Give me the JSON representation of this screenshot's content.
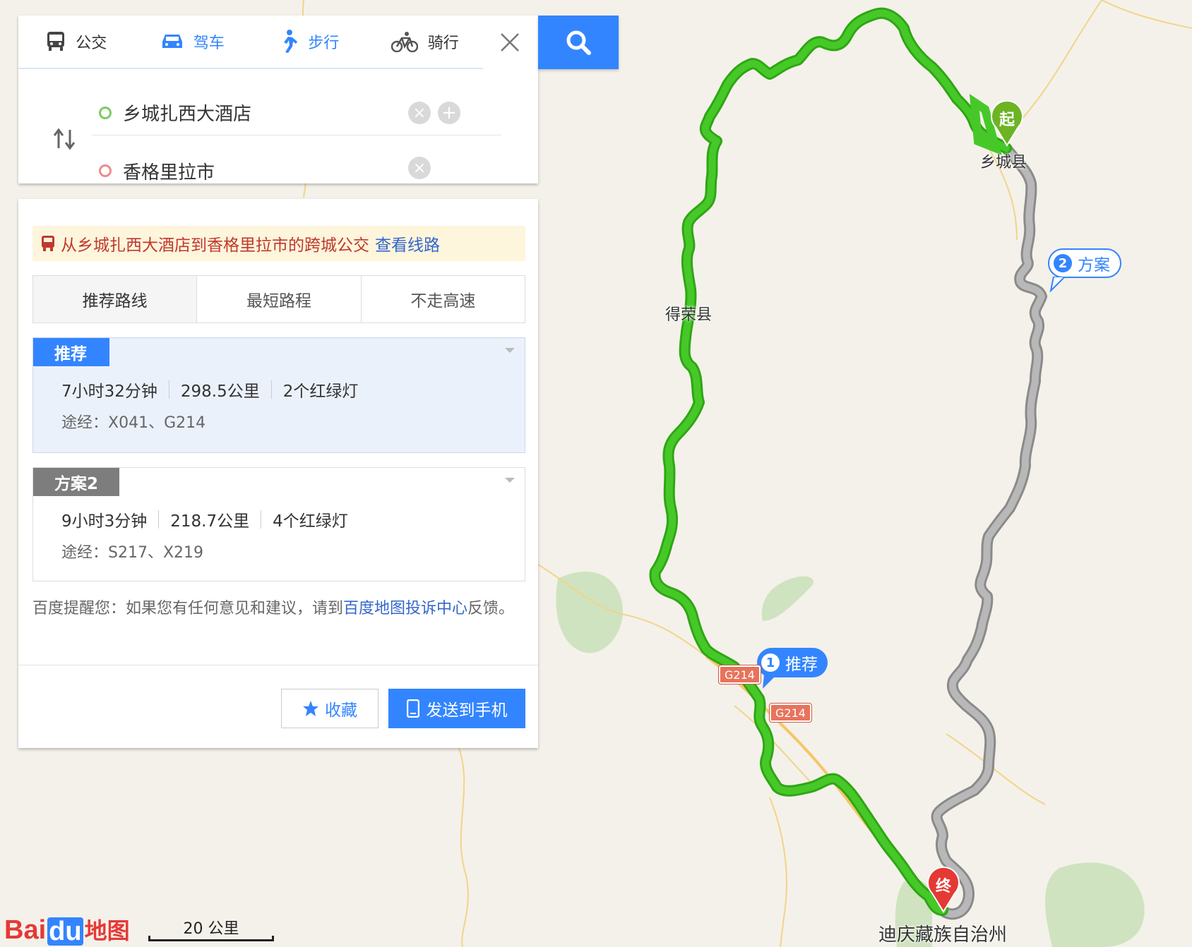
{
  "modes": {
    "bus": "公交",
    "drive": "驾车",
    "walk": "步行",
    "ride": "骑行"
  },
  "route": {
    "start": "乡城扎西大酒店",
    "end": "香格里拉市"
  },
  "bus_tip": {
    "text": "从乡城扎西大酒店到香格里拉市的跨城公交",
    "link": "查看线路"
  },
  "preferences": [
    "推荐路线",
    "最短路程",
    "不走高速"
  ],
  "plans": [
    {
      "tag": "推荐",
      "time": "7小时32分钟",
      "distance": "298.5公里",
      "lights": "2个红绿灯",
      "via": "途经：X041、G214"
    },
    {
      "tag": "方案2",
      "time": "9小时3分钟",
      "distance": "218.7公里",
      "lights": "4个红绿灯",
      "via": "途经：S217、X219"
    }
  ],
  "feedback": {
    "before": "百度提醒您：如果您有任何意见和建议，请到",
    "link": "百度地图投诉中心",
    "after": "反馈。"
  },
  "actions": {
    "favorite": "收藏",
    "send": "发送到手机"
  },
  "map": {
    "places": {
      "xiangcheng": "乡城县",
      "derong": "得荣县",
      "diqing": "迪庆藏族自治州"
    },
    "callouts": {
      "route1_num": "1",
      "route1_label": "推荐",
      "route2_num": "2",
      "route2_label": "方案"
    },
    "shields": [
      "G214",
      "G214"
    ],
    "markers": {
      "start": "起",
      "end": "终"
    },
    "scale": "20 公里",
    "logo": {
      "bai": "Bai",
      "du": "du",
      "ditu": "地图"
    }
  },
  "colors": {
    "accent": "#3385ff",
    "recommended_route": "#3fbf24",
    "alt_route": "#a9a9a9",
    "start_marker": "#6cb423",
    "end_marker": "#e53935"
  }
}
